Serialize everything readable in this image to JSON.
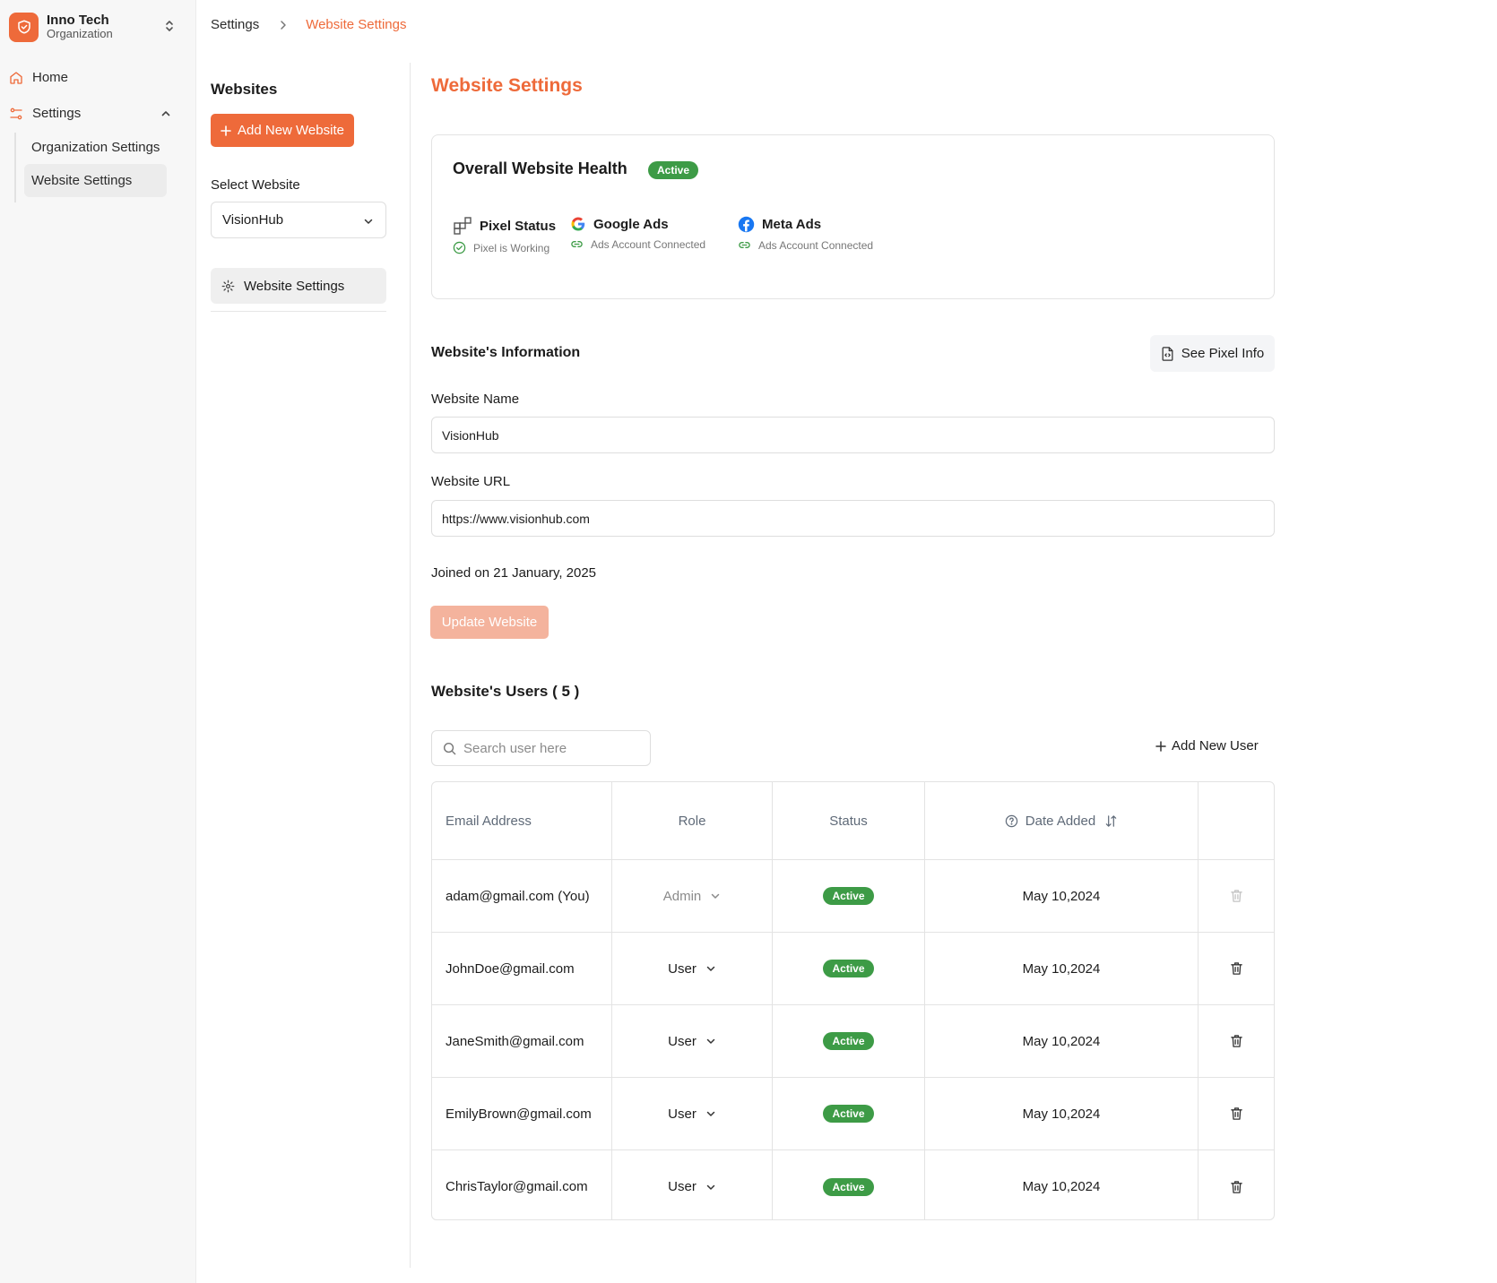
{
  "sidebar": {
    "org_name": "Inno Tech",
    "org_sub": "Organization",
    "nav": {
      "home": "Home",
      "settings": "Settings"
    },
    "sub_items": [
      "Organization Settings",
      "Website Settings"
    ]
  },
  "breadcrumb": {
    "parent": "Settings",
    "current": "Website Settings"
  },
  "panel": {
    "title": "Websites",
    "add_button": "Add New Website",
    "select_label": "Select Website",
    "selected_website": "VisionHub",
    "item": "Website Settings"
  },
  "main": {
    "title": "Website Settings",
    "health": {
      "title": "Overall Website Health",
      "badge": "Active",
      "items": [
        {
          "label": "Pixel Status",
          "sub": "Pixel is Working",
          "icon": "pixel-grid-icon"
        },
        {
          "label": "Google Ads",
          "sub": "Ads Account Connected",
          "icon": "google-icon"
        },
        {
          "label": "Meta Ads",
          "sub": "Ads Account Connected",
          "icon": "facebook-icon"
        }
      ]
    },
    "info": {
      "title": "Website's Information",
      "pixel_button": "See Pixel Info",
      "name_label": "Website Name",
      "name_value": "VisionHub",
      "url_label": "Website URL",
      "url_value": "https://www.visionhub.com",
      "joined": "Joined on 21 January, 2025",
      "update_button": "Update Website"
    },
    "users": {
      "title": "Website's Users ( 5 )",
      "search_placeholder": "Search user here",
      "add_button": "Add New User",
      "columns": [
        "Email Address",
        "Role",
        "Status",
        "Date Added"
      ],
      "rows": [
        {
          "email": "adam@gmail.com (You)",
          "role": "Admin",
          "status": "Active",
          "date": "May 10,2024"
        },
        {
          "email": "JohnDoe@gmail.com",
          "role": "User",
          "status": "Active",
          "date": "May 10,2024"
        },
        {
          "email": "JaneSmith@gmail.com",
          "role": "User",
          "status": "Active",
          "date": "May 10,2024"
        },
        {
          "email": "EmilyBrown@gmail.com",
          "role": "User",
          "status": "Active",
          "date": "May 10,2024"
        },
        {
          "email": "ChrisTaylor@gmail.com",
          "role": "User",
          "status": "Active",
          "date": "May 10,2024"
        }
      ]
    }
  },
  "colors": {
    "accent": "#ee6a3a",
    "accent_light": "#f4b39d",
    "success": "#3d9b46"
  }
}
